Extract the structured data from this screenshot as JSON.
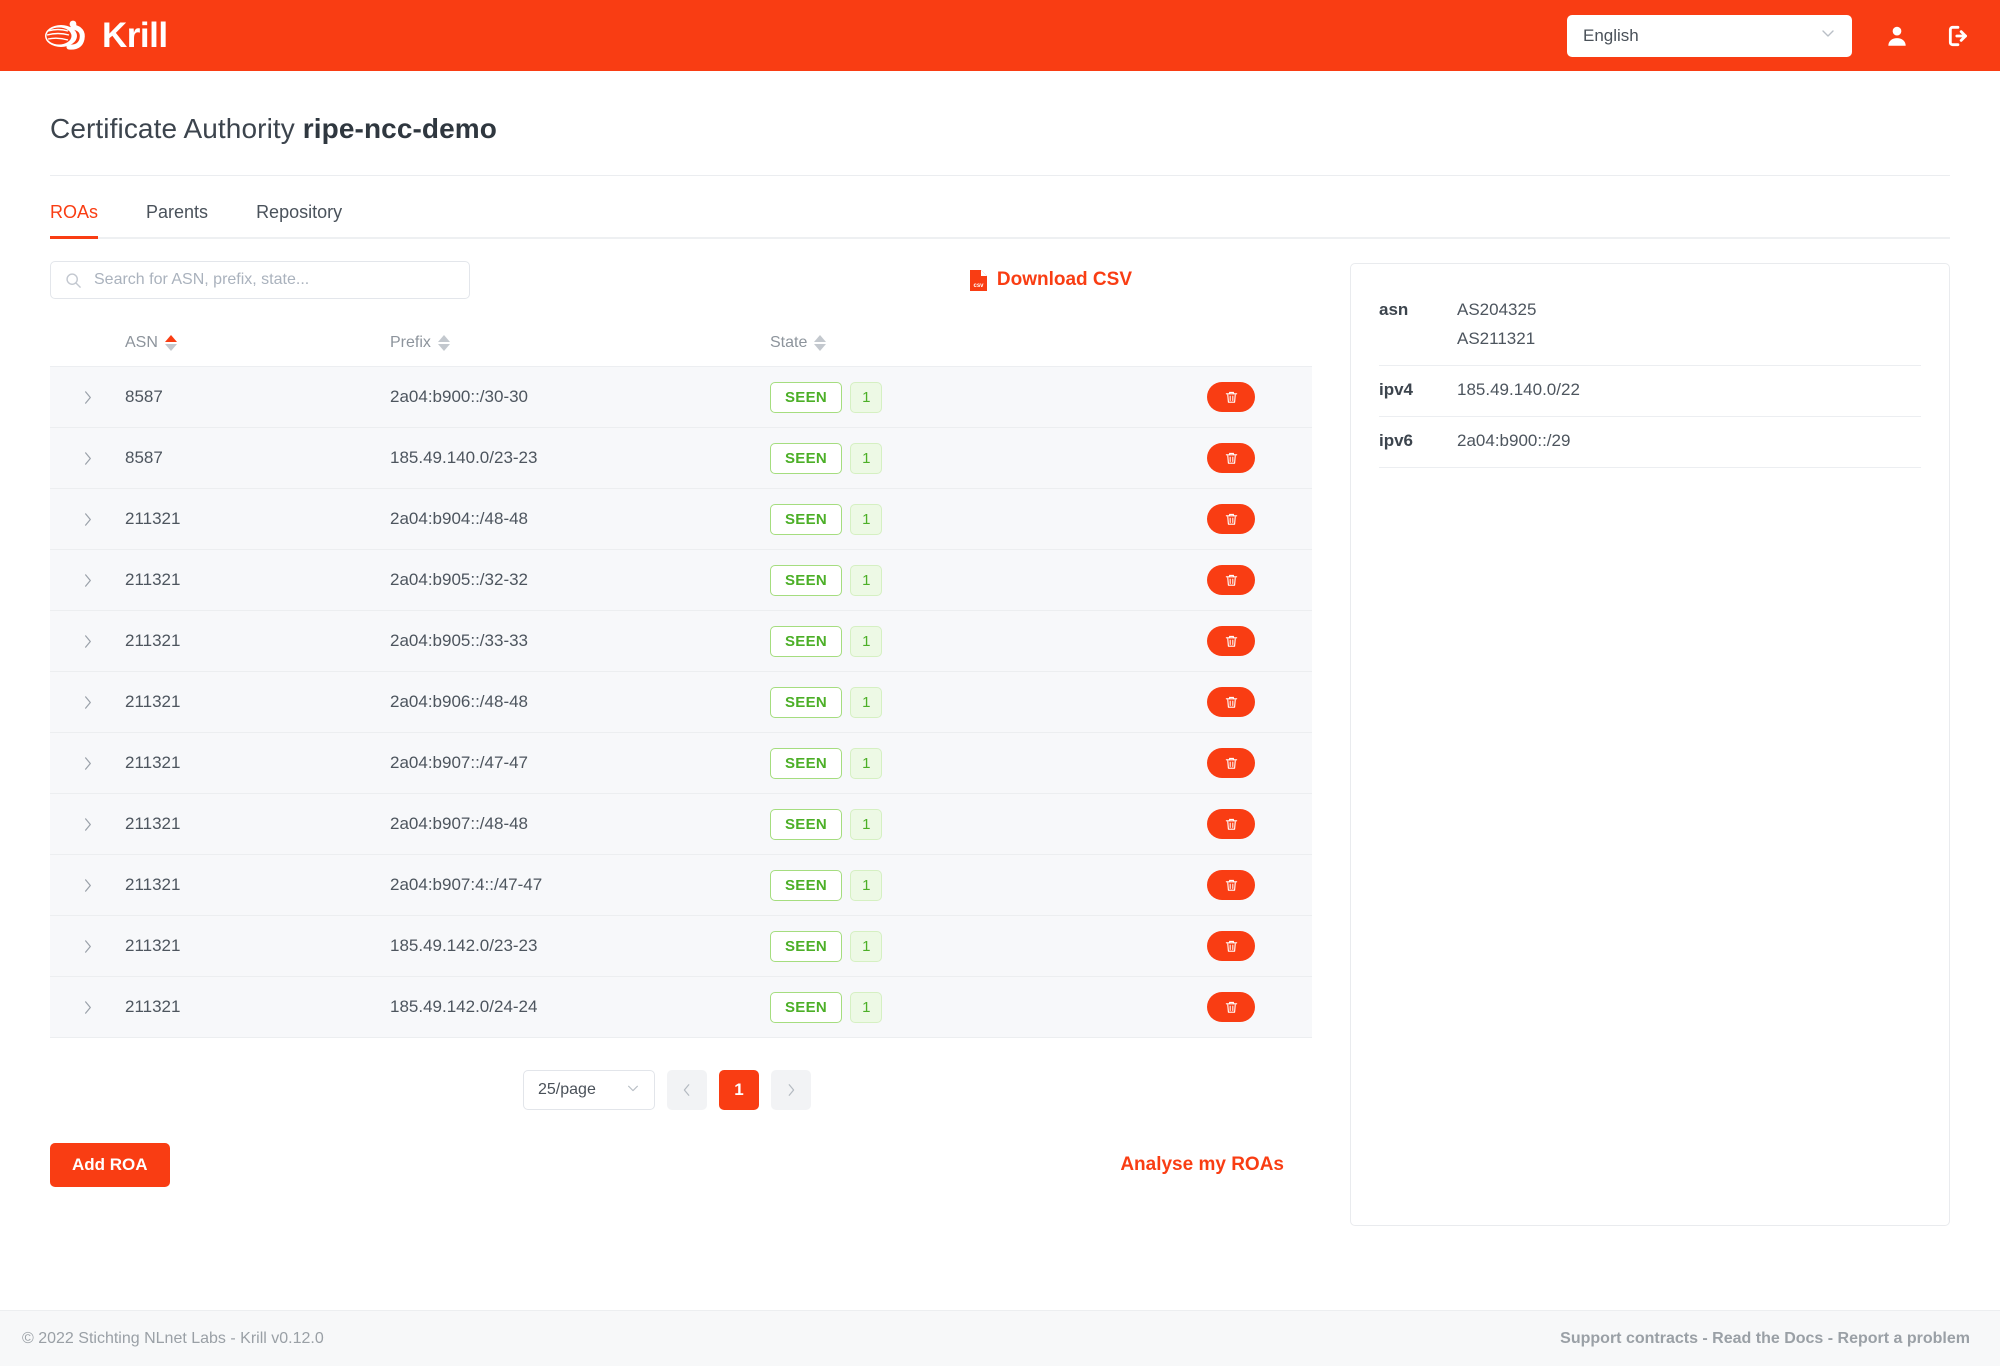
{
  "header": {
    "brand": "Krill",
    "brand_logo_icon": "krill-shrimp-logo",
    "language_value": "English",
    "language_chevron_icon": "chevron-down-icon",
    "account_icon": "user-icon",
    "logout_icon": "logout-icon",
    "accent_color": "#f93d13"
  },
  "page": {
    "title_prefix": "Certificate Authority ",
    "title_name": "ripe-ncc-demo"
  },
  "tabs": [
    {
      "label": "ROAs",
      "active": true
    },
    {
      "label": "Parents",
      "active": false
    },
    {
      "label": "Repository",
      "active": false
    }
  ],
  "toolbar": {
    "search_placeholder": "Search for ASN, prefix, state...",
    "search_value": "",
    "search_icon": "search-icon",
    "download_csv_label": "Download CSV",
    "download_csv_icon": "csv-file-icon"
  },
  "table": {
    "columns": [
      {
        "label": "ASN",
        "sort": "asc"
      },
      {
        "label": "Prefix",
        "sort": "none"
      },
      {
        "label": "State",
        "sort": "none"
      }
    ],
    "expand_icon": "chevron-right-icon",
    "delete_icon": "trash-icon",
    "rows": [
      {
        "asn": "8587",
        "prefix": "2a04:b900::/30-30",
        "state": "SEEN",
        "count": "1"
      },
      {
        "asn": "8587",
        "prefix": "185.49.140.0/23-23",
        "state": "SEEN",
        "count": "1"
      },
      {
        "asn": "211321",
        "prefix": "2a04:b904::/48-48",
        "state": "SEEN",
        "count": "1"
      },
      {
        "asn": "211321",
        "prefix": "2a04:b905::/32-32",
        "state": "SEEN",
        "count": "1"
      },
      {
        "asn": "211321",
        "prefix": "2a04:b905::/33-33",
        "state": "SEEN",
        "count": "1"
      },
      {
        "asn": "211321",
        "prefix": "2a04:b906::/48-48",
        "state": "SEEN",
        "count": "1"
      },
      {
        "asn": "211321",
        "prefix": "2a04:b907::/47-47",
        "state": "SEEN",
        "count": "1"
      },
      {
        "asn": "211321",
        "prefix": "2a04:b907::/48-48",
        "state": "SEEN",
        "count": "1"
      },
      {
        "asn": "211321",
        "prefix": "2a04:b907:4::/47-47",
        "state": "SEEN",
        "count": "1"
      },
      {
        "asn": "211321",
        "prefix": "185.49.142.0/23-23",
        "state": "SEEN",
        "count": "1"
      },
      {
        "asn": "211321",
        "prefix": "185.49.142.0/24-24",
        "state": "SEEN",
        "count": "1"
      }
    ]
  },
  "pagination": {
    "per_page_value": "25/page",
    "per_page_chevron_icon": "chevron-down-icon",
    "prev_icon": "chevron-left-icon",
    "next_icon": "chevron-right-icon",
    "current_page": "1"
  },
  "actions": {
    "add_roa_label": "Add ROA",
    "analyse_label": "Analyse my ROAs"
  },
  "info_panel": {
    "rows": [
      {
        "key": "asn",
        "values": [
          "AS204325",
          "AS211321"
        ]
      },
      {
        "key": "ipv4",
        "values": [
          "185.49.140.0/22"
        ]
      },
      {
        "key": "ipv6",
        "values": [
          "2a04:b900::/29"
        ]
      }
    ]
  },
  "footer": {
    "copyright": "© 2022 Stichting NLnet Labs - Krill v0.12.0",
    "links": "Support contracts - Read the Docs - Report a problem"
  }
}
